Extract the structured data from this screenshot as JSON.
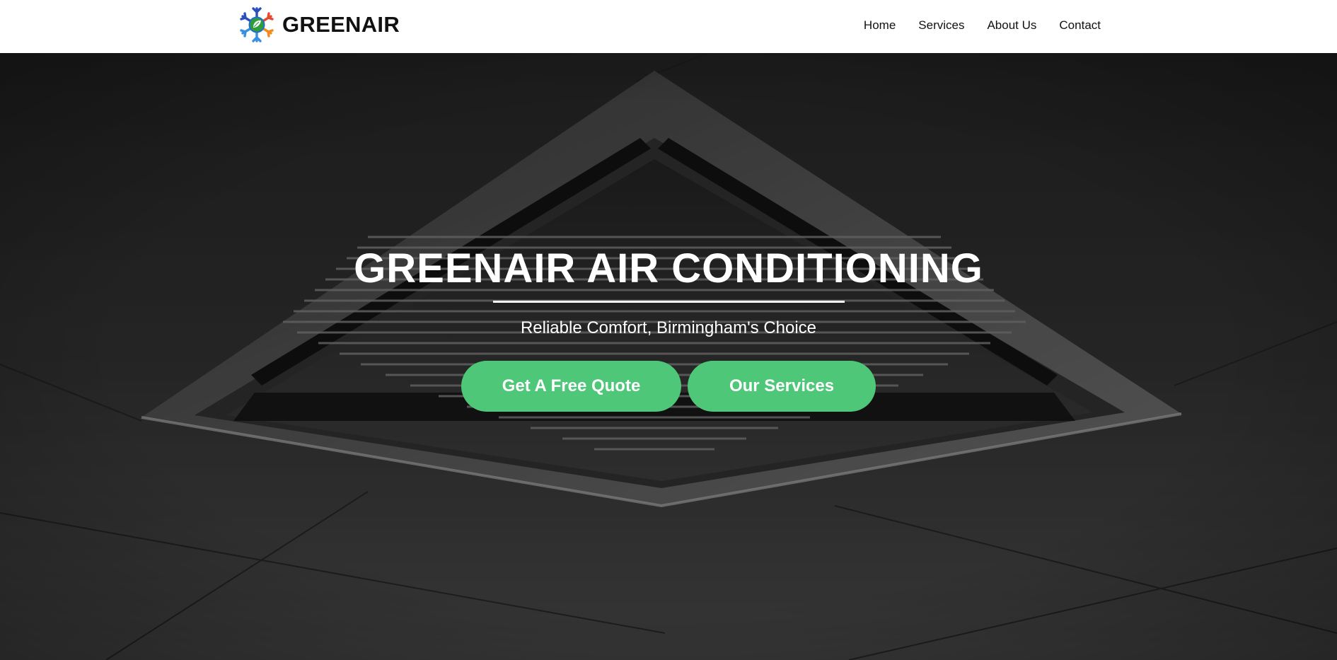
{
  "nav": {
    "brand": "GREENAIR",
    "links": [
      "Home",
      "Services",
      "About Us",
      "Contact"
    ]
  },
  "hero": {
    "title": "GREENAIR AIR CONDITIONING",
    "subtitle": "Reliable Comfort, Birmingham's Choice",
    "buttons": {
      "quote": "Get A Free Quote",
      "services": "Our Services"
    },
    "background_image": "ceiling-cassette-air-conditioner"
  },
  "colors": {
    "accent": "#4fc778",
    "navbar_bg": "#ffffff",
    "hero_overlay": "#3a3a3a",
    "text_light": "#ffffff",
    "text_dark": "#111111"
  },
  "icons": {
    "logo": "snowflake-sun-leaf-logo"
  }
}
